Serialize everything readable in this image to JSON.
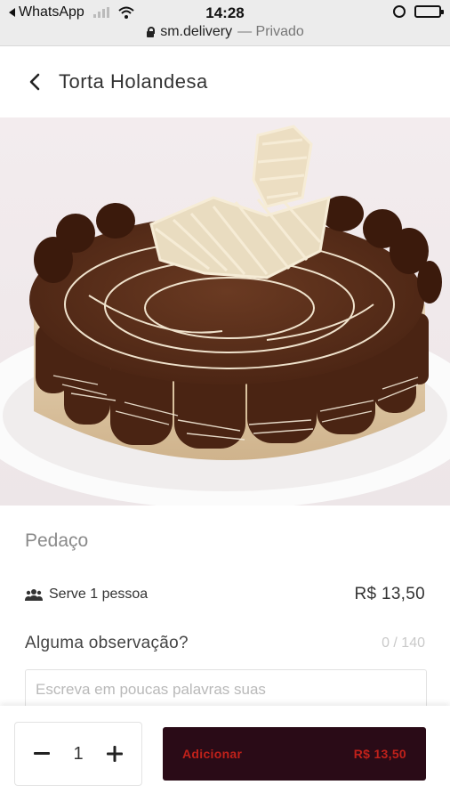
{
  "status_bar": {
    "back_app": "WhatsApp",
    "time": "14:28",
    "url": "sm.delivery",
    "url_suffix": "— Privado",
    "icons": [
      "signal-icon",
      "wifi-icon",
      "alarm-icon",
      "battery-icon",
      "lock-icon"
    ]
  },
  "header": {
    "title": "Torta Holandesa",
    "back_icon": "chevron-left-icon"
  },
  "product": {
    "image_description": "cake-photo",
    "category": "Pedaço",
    "serves": "Serve 1 pessoa",
    "serves_icon": "people-icon",
    "price": "R$ 13,50"
  },
  "observation": {
    "label": "Alguma observação?",
    "counter": "0 / 140",
    "value": "",
    "placeholder": "Escreva em poucas palavras suas"
  },
  "cart": {
    "quantity": "1",
    "add_label": "Adicionar",
    "add_price": "R$ 13,50"
  },
  "colors": {
    "button_bg": "#2a0b17",
    "button_text": "#c0211a",
    "muted_text": "#8a8a8a"
  }
}
